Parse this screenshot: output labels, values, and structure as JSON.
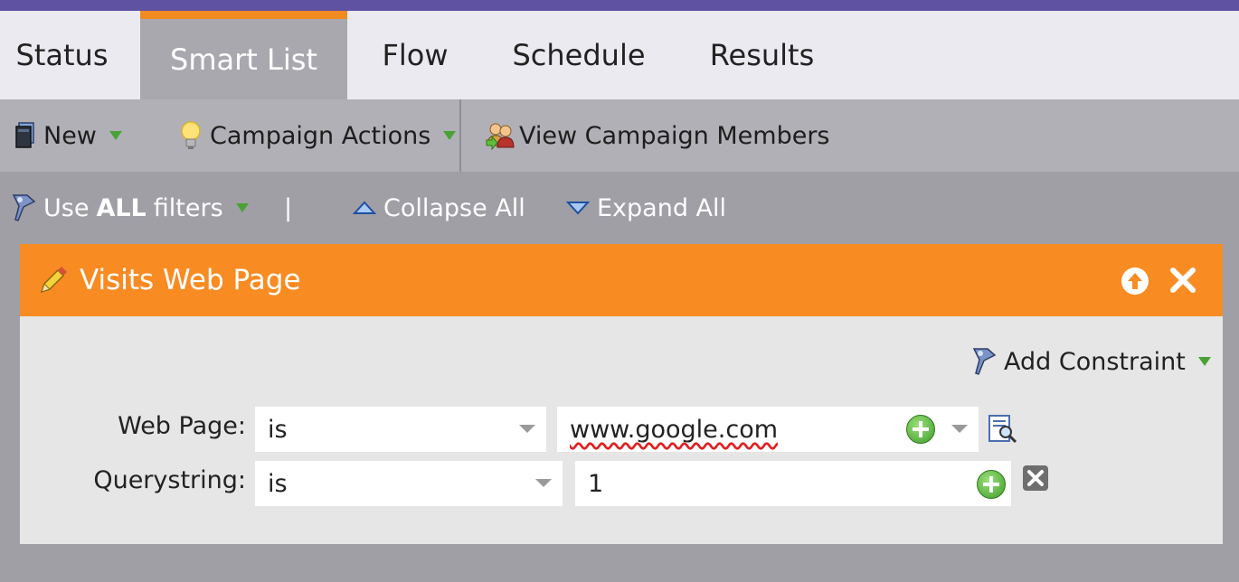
{
  "tabs": [
    {
      "label": "Status",
      "active": false
    },
    {
      "label": "Smart List",
      "active": true
    },
    {
      "label": "Flow",
      "active": false
    },
    {
      "label": "Schedule",
      "active": false
    },
    {
      "label": "Results",
      "active": false
    }
  ],
  "toolbar": {
    "new_label": "New",
    "campaign_actions_label": "Campaign Actions",
    "view_members_label": "View Campaign Members"
  },
  "filterbar": {
    "use_prefix": "Use",
    "use_bold": "ALL",
    "use_suffix": "filters",
    "separator": "|",
    "collapse_label": "Collapse All",
    "expand_label": "Expand All"
  },
  "filter": {
    "title": "Visits Web Page",
    "add_constraint_label": "Add Constraint",
    "rows": [
      {
        "label": "Web Page:",
        "operator": "is",
        "value": "www.google.com"
      },
      {
        "label": "Querystring:",
        "operator": "is",
        "value": "1"
      }
    ]
  },
  "colors": {
    "top_accent": "#5f52a3",
    "active_tab_border": "#f18a21",
    "filter_header": "#f88b22",
    "dropdown_arrow": "#4aa236"
  },
  "icons": {
    "new": "new-document-icon",
    "campaign_actions": "lightbulb-icon",
    "view_members": "people-icon",
    "filters": "filter-icon",
    "collapse": "triangle-up-icon",
    "expand": "triangle-down-icon",
    "filter_type": "pencil-icon",
    "move_up": "arrow-up-circle-icon",
    "remove": "close-icon",
    "lookup": "search-list-icon",
    "delete_constraint": "delete-box-icon"
  }
}
